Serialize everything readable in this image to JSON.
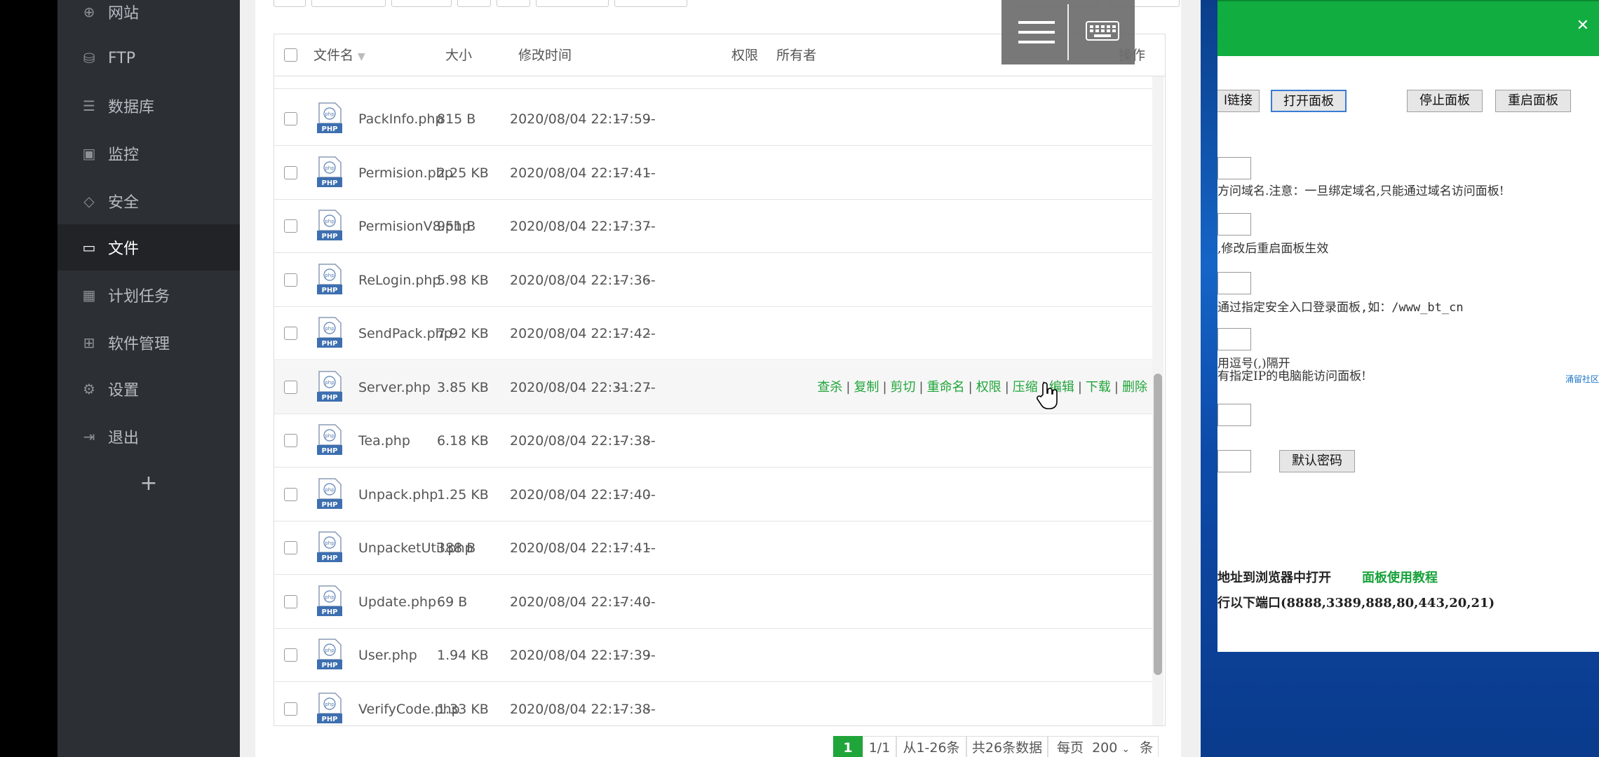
{
  "sidebar": {
    "items": [
      {
        "label": "网站",
        "icon": "globe-icon",
        "glyph": "⊕"
      },
      {
        "label": "FTP",
        "icon": "ftp-icon",
        "glyph": "⛁"
      },
      {
        "label": "数据库",
        "icon": "database-icon",
        "glyph": "☰"
      },
      {
        "label": "监控",
        "icon": "monitor-icon",
        "glyph": "▣"
      },
      {
        "label": "安全",
        "icon": "shield-icon",
        "glyph": "◇"
      },
      {
        "label": "文件",
        "icon": "folder-icon",
        "glyph": "▭"
      },
      {
        "label": "计划任务",
        "icon": "calendar-icon",
        "glyph": "▦"
      },
      {
        "label": "软件管理",
        "icon": "grid-icon",
        "glyph": "⊞"
      },
      {
        "label": "设置",
        "icon": "gear-icon",
        "glyph": "⚙"
      },
      {
        "label": "退出",
        "icon": "logout-icon",
        "glyph": "⇥"
      }
    ],
    "add_label": "+"
  },
  "table": {
    "headers": {
      "name": "文件名",
      "size": "大小",
      "mtime": "修改时间",
      "perm": "权限",
      "owner": "所有者",
      "ops": "操作"
    },
    "rows": [
      {
        "name": "PackInfo.php",
        "size": "815 B",
        "mtime": "2020/08/04 22:17:59",
        "perm": "--",
        "owner": "--"
      },
      {
        "name": "Permision.php",
        "size": "2.25 KB",
        "mtime": "2020/08/04 22:17:41",
        "perm": "--",
        "owner": "--"
      },
      {
        "name": "PermisionV8.php",
        "size": "951 B",
        "mtime": "2020/08/04 22:17:37",
        "perm": "--",
        "owner": "--"
      },
      {
        "name": "ReLogin.php",
        "size": "5.98 KB",
        "mtime": "2020/08/04 22:17:36",
        "perm": "--",
        "owner": "--"
      },
      {
        "name": "SendPack.php",
        "size": "7.92 KB",
        "mtime": "2020/08/04 22:17:42",
        "perm": "--",
        "owner": "--"
      },
      {
        "name": "Server.php",
        "size": "3.85 KB",
        "mtime": "2020/08/04 22:31:27",
        "perm": "--",
        "owner": "--"
      },
      {
        "name": "Tea.php",
        "size": "6.18 KB",
        "mtime": "2020/08/04 22:17:38",
        "perm": "--",
        "owner": "--"
      },
      {
        "name": "Unpack.php",
        "size": "1.25 KB",
        "mtime": "2020/08/04 22:17:40",
        "perm": "--",
        "owner": "--"
      },
      {
        "name": "UnpacketUtil.php",
        "size": "388 B",
        "mtime": "2020/08/04 22:17:41",
        "perm": "--",
        "owner": "--"
      },
      {
        "name": "Update.php",
        "size": "69 B",
        "mtime": "2020/08/04 22:17:40",
        "perm": "--",
        "owner": "--"
      },
      {
        "name": "User.php",
        "size": "1.94 KB",
        "mtime": "2020/08/04 22:17:39",
        "perm": "--",
        "owner": "--"
      },
      {
        "name": "VerifyCode.php",
        "size": "1.33 KB",
        "mtime": "2020/08/04 22:17:38",
        "perm": "--",
        "owner": "--"
      }
    ],
    "hover_row_actions": [
      "查杀",
      "复制",
      "剪切",
      "重命名",
      "权限",
      "压缩",
      "编辑",
      "下载",
      "删除"
    ],
    "file_icon_label": "PHP"
  },
  "pagination": {
    "current": "1",
    "pages": "1/1",
    "range": "从1-26条",
    "total": "共26条数据",
    "per_page_label": "每页",
    "per_page_value": "200",
    "unit": "条"
  },
  "remote_window": {
    "buttons": {
      "partial_link": "l链接",
      "open_panel": "打开面板",
      "stop_panel": "停止面板",
      "restart_panel": "重启面板",
      "default_password": "默认密码"
    },
    "texts": {
      "domain_note": "方问域名.注意：一旦绑定域名,只能通过域名访问面板!",
      "restart_note": ",修改后重启面板生效",
      "entry_note": "通过指定安全入口登录面板,如：/www_bt_cn",
      "comma_note": "用逗号(,)隔开",
      "ip_note": "有指定IP的电脑能访问面板!",
      "addr_note": "地址到浏览器中打开",
      "port_note": "行以下端口(8888,3389,888,80,443,20,21)"
    },
    "links": {
      "tutorial": "面板使用教程",
      "community": "涌留社区"
    },
    "close_glyph": "✕"
  },
  "colors": {
    "accent": "#20a53a",
    "sidebar_bg": "#2c2f34",
    "window_title": "#12ad41"
  }
}
